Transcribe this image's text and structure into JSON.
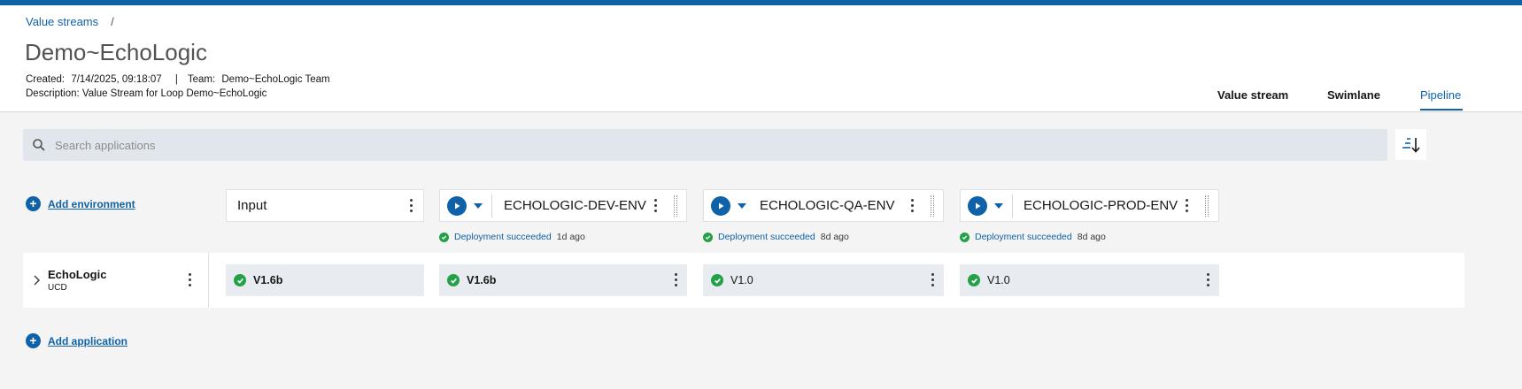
{
  "breadcrumb": {
    "items": [
      "Value streams"
    ],
    "separator": "/"
  },
  "page": {
    "title": "Demo~EchoLogic",
    "created_label": "Created:",
    "created_value": "7/14/2025, 09:18:07",
    "meta_separator": "|",
    "team_label": "Team:",
    "team_value": "Demo~EchoLogic Team",
    "description_label": "Description:",
    "description_value": "Value Stream for Loop Demo~EchoLogic"
  },
  "tabs": [
    {
      "label": "Value stream",
      "active": false
    },
    {
      "label": "Swimlane",
      "active": false
    },
    {
      "label": "Pipeline",
      "active": true
    }
  ],
  "search": {
    "placeholder": "Search applications",
    "value": ""
  },
  "actions": {
    "add_environment": "Add environment",
    "add_application": "Add application"
  },
  "input_column": {
    "label": "Input"
  },
  "environments": [
    {
      "name": "ECHOLOGIC-DEV-ENV",
      "status": "Deployment succeeded",
      "time": "1d ago"
    },
    {
      "name": "ECHOLOGIC-QA-ENV",
      "status": "Deployment succeeded",
      "time": "8d ago"
    },
    {
      "name": "ECHOLOGIC-PROD-ENV",
      "status": "Deployment succeeded",
      "time": "8d ago"
    }
  ],
  "applications": [
    {
      "name": "EchoLogic",
      "subtitle": "UCD",
      "versions": {
        "input": "V1.6b",
        "dev": "V1.6b",
        "qa": "V1.0",
        "prod": "V1.0"
      }
    }
  ],
  "colors": {
    "brand": "#0f62a8",
    "success": "#24a148",
    "background": "#f4f4f4"
  }
}
